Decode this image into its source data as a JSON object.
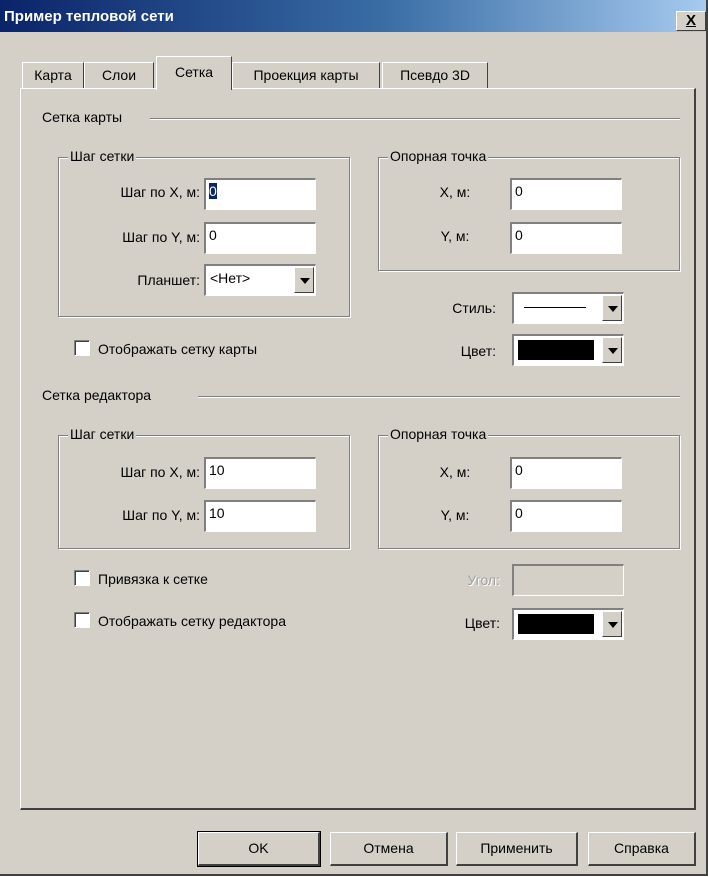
{
  "window": {
    "title": "Пример тепловой сети",
    "close_label": "X"
  },
  "tabs": [
    "Карта",
    "Слои",
    "Сетка",
    "Проекция карты",
    "Псевдо 3D"
  ],
  "map_grid": {
    "section_title": "Сетка карты",
    "step_group": {
      "title": "Шаг сетки",
      "x_label": "Шаг по X, м:",
      "x_value": "0",
      "y_label": "Шаг по Y, м:",
      "y_value": "0",
      "tablet_label": "Планшет:",
      "tablet_value": "<Нет>"
    },
    "ref_group": {
      "title": "Опорная точка",
      "x_label": "X, м:",
      "x_value": "0",
      "y_label": "Y, м:",
      "y_value": "0"
    },
    "style_label": "Стиль:",
    "color_label": "Цвет:",
    "color_value": "#000000",
    "show_label": "Отображать сетку карты"
  },
  "editor_grid": {
    "section_title": "Сетка редактора",
    "step_group": {
      "title": "Шаг сетки",
      "x_label": "Шаг по X, м:",
      "x_value": "10",
      "y_label": "Шаг по Y, м:",
      "y_value": "10"
    },
    "ref_group": {
      "title": "Опорная точка",
      "x_label": "X, м:",
      "x_value": "0",
      "y_label": "Y, м:",
      "y_value": "0"
    },
    "snap_label": "Привязка к сетке",
    "show_label": "Отображать сетку редактора",
    "angle_label": "Угол:",
    "angle_value": "",
    "color_label": "Цвет:",
    "color_value": "#000000"
  },
  "buttons": {
    "ok": "OK",
    "cancel": "Отмена",
    "apply": "Применить",
    "help": "Справка"
  }
}
